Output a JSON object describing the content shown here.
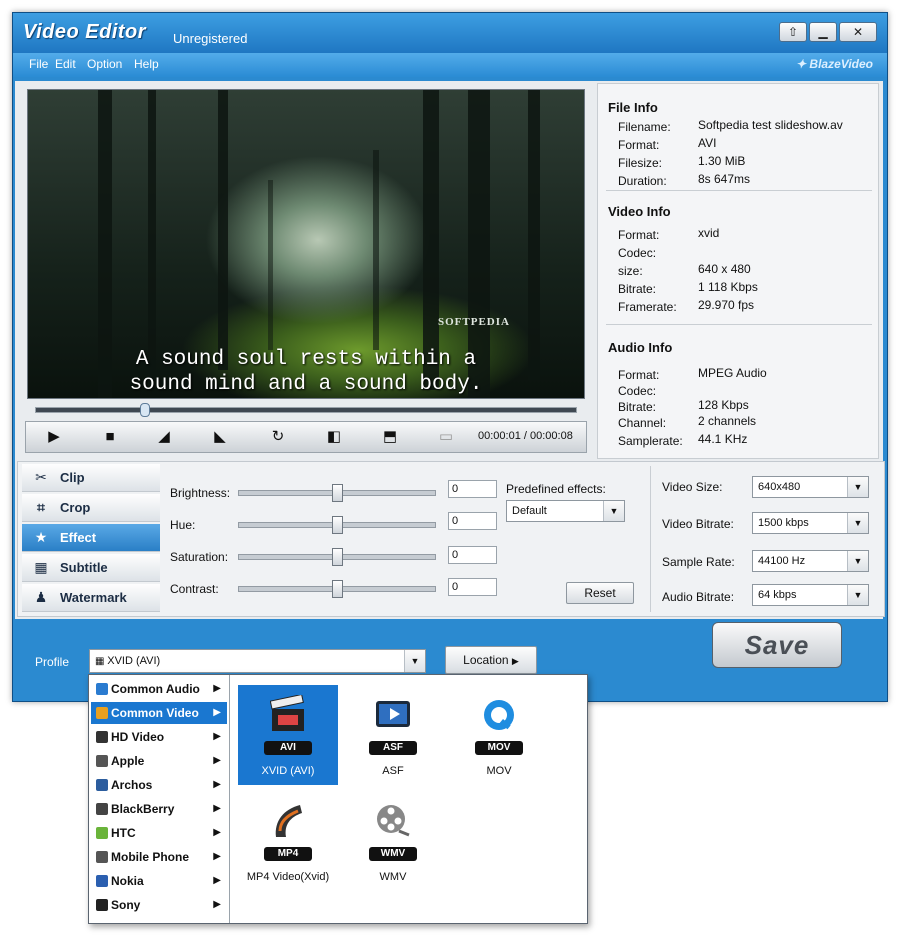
{
  "window": {
    "title": "Video Editor",
    "subtitle": "Unregistered",
    "brand": "BlazeVideo"
  },
  "menu": [
    "File",
    "Edit",
    "Option",
    "Help"
  ],
  "preview": {
    "watermark": "SOFTPEDIA",
    "caption_line1": "A sound soul rests within a",
    "caption_line2": "sound mind and a sound body.",
    "time": "00:00:01 / 00:00:08",
    "seek_fraction": 0.2
  },
  "info": {
    "file": {
      "heading": "File Info",
      "rows": [
        {
          "label": "Filename:",
          "value": "Softpedia test slideshow.av"
        },
        {
          "label": "Format:",
          "value": "AVI"
        },
        {
          "label": "Filesize:",
          "value": "1.30 MiB"
        },
        {
          "label": "Duration:",
          "value": "8s 647ms"
        }
      ]
    },
    "video": {
      "heading": "Video Info",
      "rows": [
        {
          "label": "Format:",
          "value": "xvid"
        },
        {
          "label": "Codec:",
          "value": ""
        },
        {
          "label": "size:",
          "value": "640 x 480"
        },
        {
          "label": "Bitrate:",
          "value": "1 118 Kbps"
        },
        {
          "label": "Framerate:",
          "value": "29.970 fps"
        }
      ]
    },
    "audio": {
      "heading": "Audio Info",
      "rows": [
        {
          "label": "Format:",
          "value": "MPEG Audio"
        },
        {
          "label": "Codec:",
          "value": ""
        },
        {
          "label": "Bitrate:",
          "value": "128 Kbps"
        },
        {
          "label": "Channel:",
          "value": "2 channels"
        },
        {
          "label": "Samplerate:",
          "value": "44.1 KHz"
        }
      ]
    }
  },
  "tabs": [
    {
      "label": "Clip",
      "icon": "scissors-icon"
    },
    {
      "label": "Crop",
      "icon": "crop-icon"
    },
    {
      "label": "Effect",
      "icon": "star-icon"
    },
    {
      "label": "Subtitle",
      "icon": "film-icon"
    },
    {
      "label": "Watermark",
      "icon": "person-icon"
    }
  ],
  "effects": {
    "sliders": [
      {
        "label": "Brightness:",
        "value": "0",
        "fraction": 0.5
      },
      {
        "label": "Hue:",
        "value": "0",
        "fraction": 0.5
      },
      {
        "label": "Saturation:",
        "value": "0",
        "fraction": 0.5
      },
      {
        "label": "Contrast:",
        "value": "0",
        "fraction": 0.5
      }
    ],
    "predefined_label": "Predefined effects:",
    "predefined_value": "Default",
    "reset": "Reset"
  },
  "output": [
    {
      "label": "Video Size:",
      "value": "640x480"
    },
    {
      "label": "Video Bitrate:",
      "value": "1500 kbps"
    },
    {
      "label": "Sample Rate:",
      "value": "44100 Hz"
    },
    {
      "label": "Audio Bitrate:",
      "value": "64 kbps"
    }
  ],
  "profile": {
    "label": "Profile",
    "value": "XVID (AVI)",
    "location": "Location",
    "save": "Save"
  },
  "popup": {
    "categories": [
      {
        "label": "Common Audio",
        "color": "#2a7bd0"
      },
      {
        "label": "Common Video",
        "color": "#e8a020"
      },
      {
        "label": "HD Video",
        "color": "#333333"
      },
      {
        "label": "Apple",
        "color": "#555555"
      },
      {
        "label": "Archos",
        "color": "#2c5d9e"
      },
      {
        "label": "BlackBerry",
        "color": "#444444"
      },
      {
        "label": "HTC",
        "color": "#6ab43a"
      },
      {
        "label": "Mobile Phone",
        "color": "#555555"
      },
      {
        "label": "Nokia",
        "color": "#2b5fb0"
      },
      {
        "label": "Sony",
        "color": "#222222"
      }
    ],
    "selected_category": 1,
    "formats": [
      {
        "name": "XVID (AVI)",
        "badge": "AVI",
        "icon": "clapperboard-icon"
      },
      {
        "name": "ASF",
        "badge": "ASF",
        "icon": "monitor-play-icon"
      },
      {
        "name": "MOV",
        "badge": "MOV",
        "icon": "quicktime-icon"
      },
      {
        "name": "MP4 Video(Xvid)",
        "badge": "MP4",
        "icon": "film-strip-icon"
      },
      {
        "name": "WMV",
        "badge": "WMV",
        "icon": "film-reel-icon"
      }
    ],
    "selected_format": 0
  }
}
